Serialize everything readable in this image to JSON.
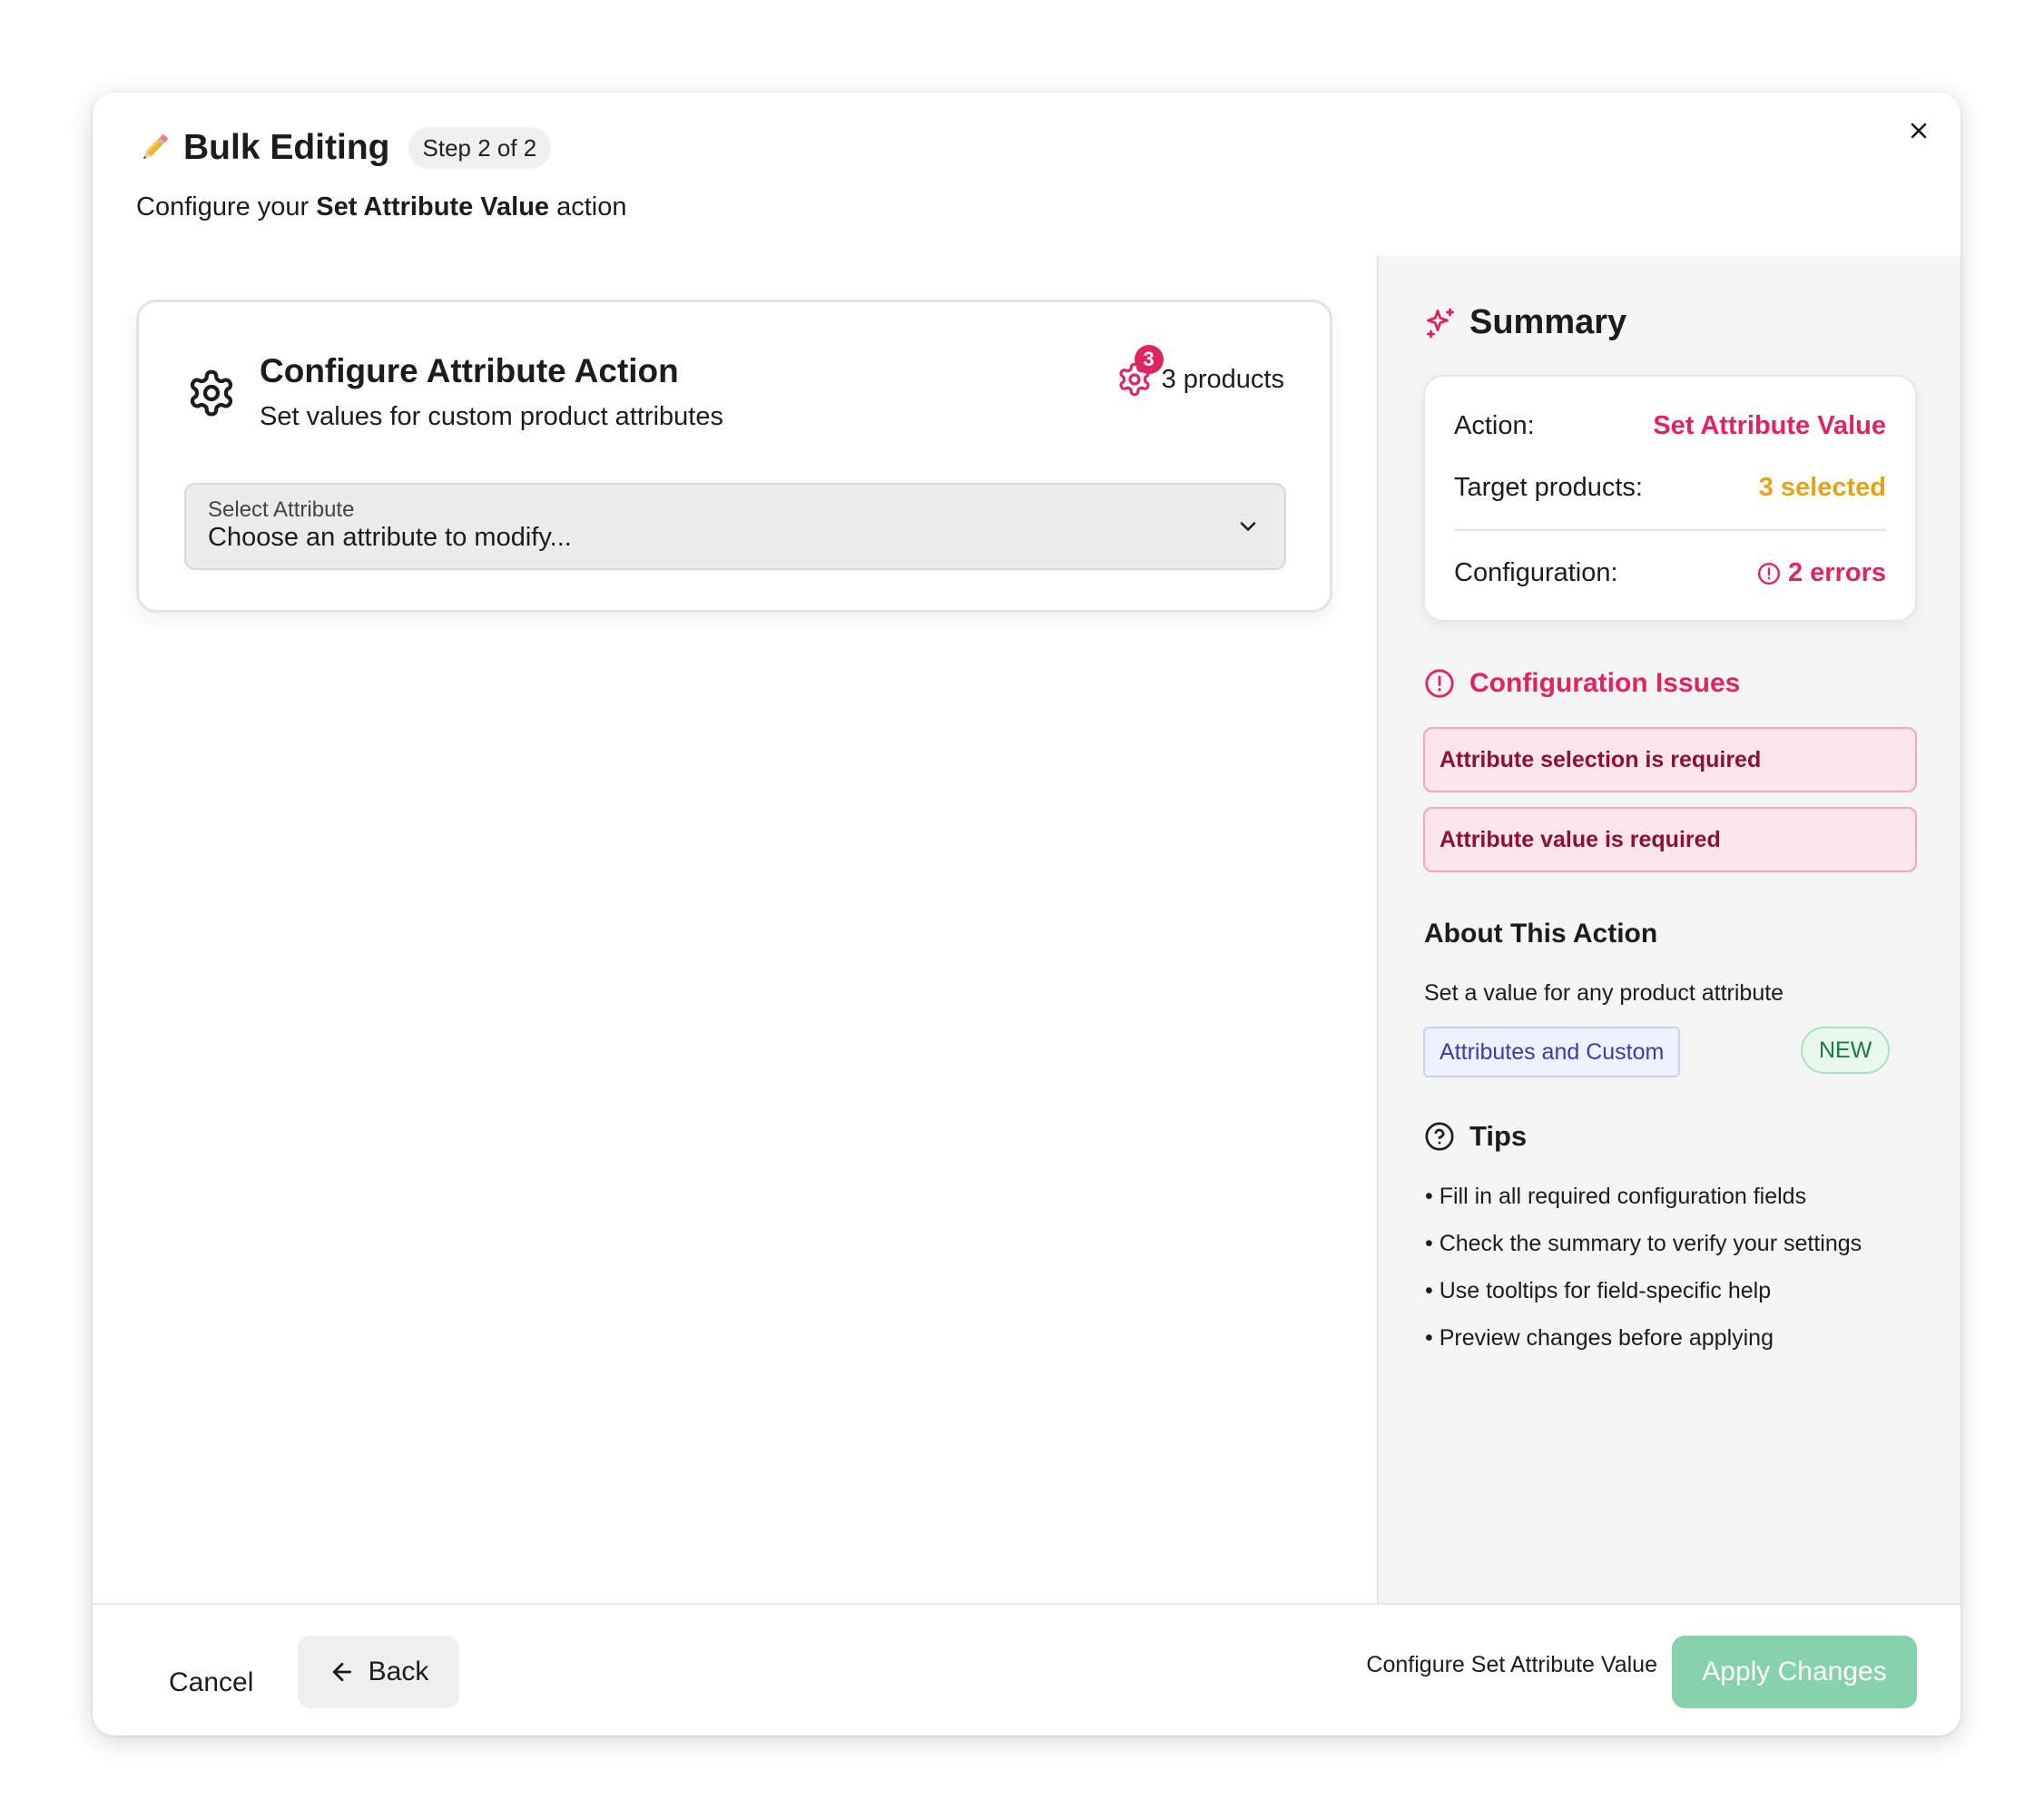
{
  "header": {
    "title": "Bulk Editing",
    "step": "Step 2 of 2",
    "subtitle_prefix": "Configure your",
    "subtitle_action": "Set Attribute Value",
    "subtitle_suffix": "action",
    "close_icon": "close-icon"
  },
  "config_card": {
    "title": "Configure Attribute Action",
    "subtitle": "Set values for custom product attributes",
    "products_count": "3",
    "products_label": "3 products",
    "select": {
      "label": "Select Attribute",
      "placeholder": "Choose an attribute to modify..."
    }
  },
  "summary": {
    "title": "Summary",
    "rows": [
      {
        "key": "Action:",
        "value": "Set Attribute Value",
        "color": "#e0245e"
      },
      {
        "key": "Target products:",
        "value": "3 selected",
        "color": "#e3a21a"
      },
      {
        "key": "Configuration:",
        "value": "2 errors",
        "color": "#e0245e"
      }
    ]
  },
  "issues": {
    "title": "Configuration Issues",
    "items": [
      "Attribute selection is required",
      "Attribute value is required"
    ]
  },
  "about": {
    "title": "About This Action",
    "description": "Set a value for any product attribute",
    "tags": [
      "Attributes and Custom",
      "NEW"
    ]
  },
  "tips": {
    "title": "Tips",
    "items": [
      "• Fill in all required configuration fields",
      "• Check the summary to verify your settings",
      "• Use tooltips for field-specific help",
      "• Preview changes before applying"
    ]
  },
  "footer": {
    "cancel": "Cancel",
    "back": "Back",
    "hint": "Configure Set Attribute Value",
    "apply": "Apply Changes"
  },
  "colors": {
    "accent_pink": "#e0245e",
    "accent_amber": "#e3a21a",
    "apply_disabled": "#86d2ac"
  }
}
